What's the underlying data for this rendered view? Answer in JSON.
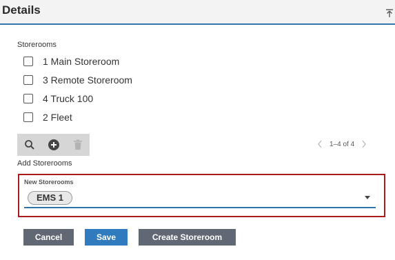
{
  "header": {
    "title": "Details",
    "pin_icon": "pin-top-icon"
  },
  "storerooms": {
    "label": "Storerooms",
    "items": [
      {
        "label": "1 Main Storeroom",
        "checked": false
      },
      {
        "label": "3 Remote Storeroom",
        "checked": false
      },
      {
        "label": "4 Truck 100",
        "checked": false
      },
      {
        "label": "2 Fleet",
        "checked": false
      }
    ]
  },
  "toolbar": {
    "icons": [
      "search-icon",
      "add-icon",
      "delete-icon"
    ]
  },
  "pager": {
    "text": "1–4 of 4"
  },
  "add_label": "Add Storerooms",
  "new_storerooms": {
    "label": "New Storerooms",
    "selected": [
      "EMS 1"
    ]
  },
  "buttons": {
    "cancel": "Cancel",
    "save": "Save",
    "create": "Create Storeroom"
  },
  "colors": {
    "accent": "#2f73a8",
    "highlight_border": "#a81b1b",
    "save": "#2f7bbd",
    "secondary": "#626873"
  }
}
